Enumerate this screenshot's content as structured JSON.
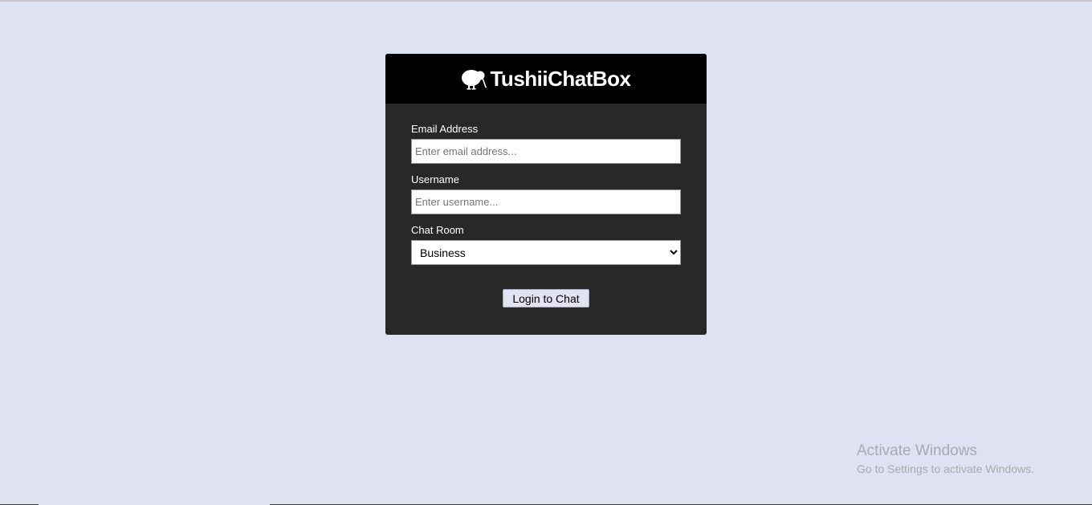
{
  "app": {
    "brand": "TushiiChatBox",
    "logo_icon": "kiwi-bird-icon"
  },
  "form": {
    "email": {
      "label": "Email Address",
      "placeholder": "Enter email address...",
      "value": ""
    },
    "username": {
      "label": "Username",
      "placeholder": "Enter username...",
      "value": ""
    },
    "room": {
      "label": "Chat Room",
      "selected": "Business"
    },
    "submit_label": "Login to Chat"
  },
  "watermark": {
    "title": "Activate Windows",
    "subtitle": "Go to Settings to activate Windows."
  },
  "colors": {
    "page_background": "#dfe2f3",
    "card_background": "#282828",
    "header_background": "#000000",
    "button_background": "#e1e3f3"
  }
}
